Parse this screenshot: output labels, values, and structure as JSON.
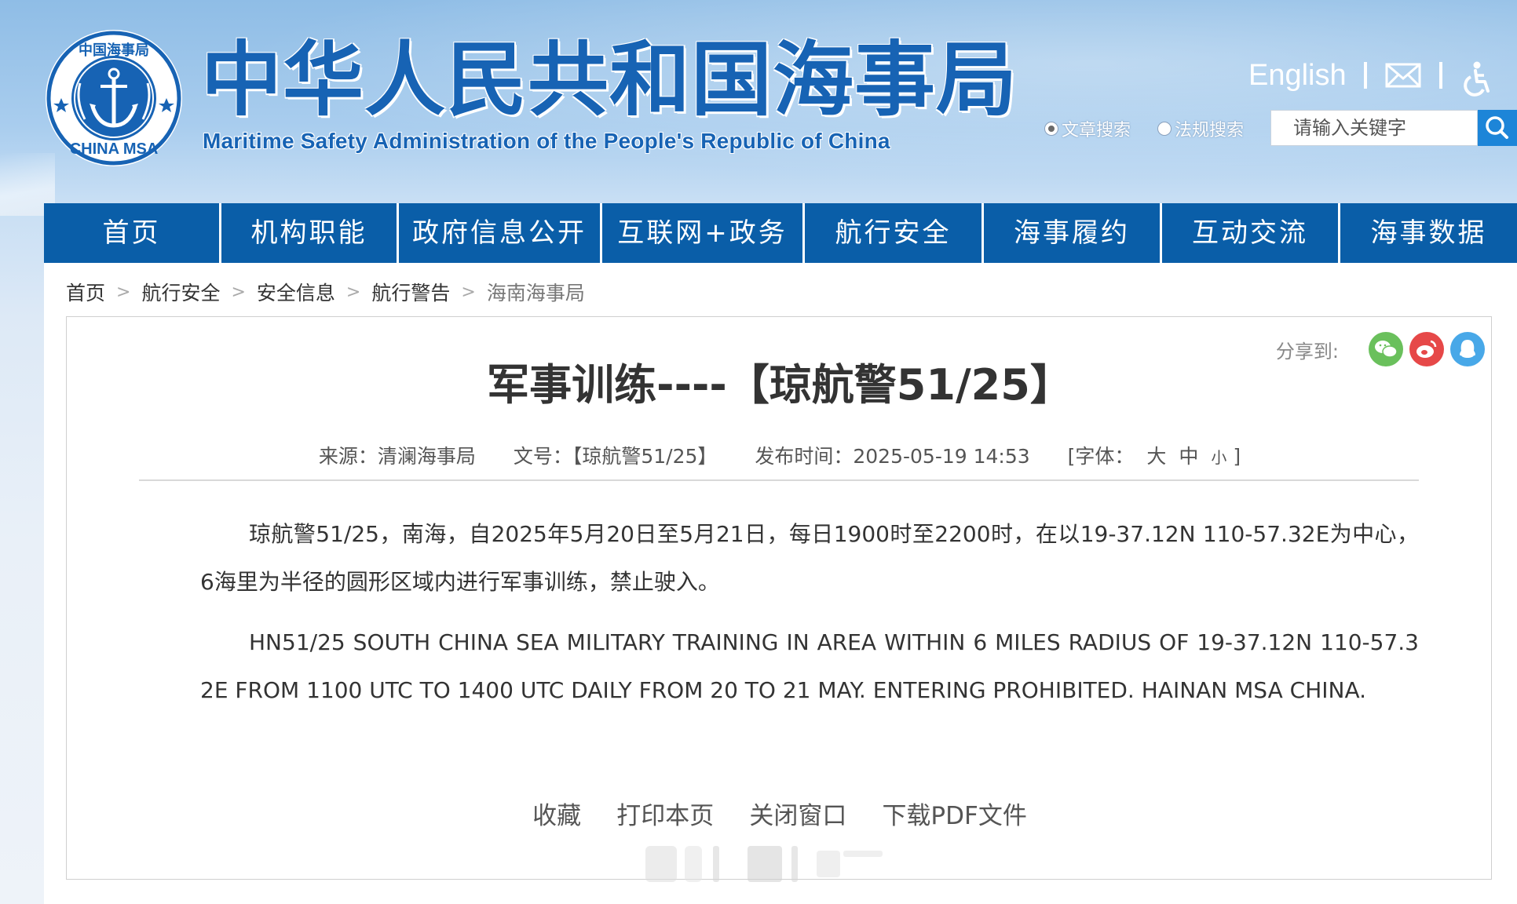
{
  "header": {
    "logo": {
      "icon": "china-msa-emblem-icon",
      "ring_text_cn": "中国海事局",
      "ring_text_en": "CHINA MSA"
    },
    "title_cn": "中华人民共和国海事局",
    "title_en": "Maritime Safety Administration of the People's Republic of China",
    "language_link": "English",
    "mail_icon": "mail-icon",
    "accessibility_icon": "accessibility-icon"
  },
  "search": {
    "options": [
      "文章搜索",
      "法规搜索"
    ],
    "selected_option": "文章搜索",
    "placeholder": "请输入关键字",
    "value": "",
    "button_icon": "search-icon"
  },
  "nav": {
    "items": [
      "首页",
      "机构职能",
      "政府信息公开",
      "互联网+政务",
      "航行安全",
      "海事履约",
      "互动交流",
      "海事数据"
    ]
  },
  "breadcrumb": {
    "items": [
      "首页",
      "航行安全",
      "安全信息",
      "航行警告",
      "海南海事局"
    ],
    "separator": ">"
  },
  "share": {
    "label": "分享到:",
    "icons": [
      "wechat-icon",
      "weibo-icon",
      "qq-icon"
    ]
  },
  "article": {
    "title": "军事训练----【琼航警51/25】",
    "meta": {
      "source": "来源：清澜海事局",
      "doc_no": "文号：【琼航警51/25】",
      "publish_time": "发布时间：2025-05-19 14:53",
      "font_label_open": "[字体：",
      "font_sizes": [
        "大",
        "中",
        "小"
      ],
      "font_label_close": "]"
    },
    "paragraphs": [
      "琼航警51/25，南海，自2025年5月20日至5月21日，每日1900时至2200时，在以19-37.12N 110-57.32E为中心，6海里为半径的圆形区域内进行军事训练，禁止驶入。",
      "HN51/25 SOUTH CHINA SEA MILITARY TRAINING IN AREA WITHIN 6 MILES RADIUS OF 19-37.12N 110-57.32E FROM 1100 UTC TO 1400 UTC DAILY FROM 20 TO 21 MAY. ENTERING PROHIBITED. HAINAN MSA CHINA."
    ],
    "actions": [
      "收藏",
      "打印本页",
      "关闭窗口",
      "下载PDF文件"
    ]
  },
  "colors": {
    "brand_blue": "#1763b4",
    "nav_blue": "#0a5ea8",
    "search_button": "#1d85d8",
    "text": "#333333",
    "wechat": "#6ac05c",
    "weibo": "#e64848",
    "qq": "#48a8e8"
  }
}
